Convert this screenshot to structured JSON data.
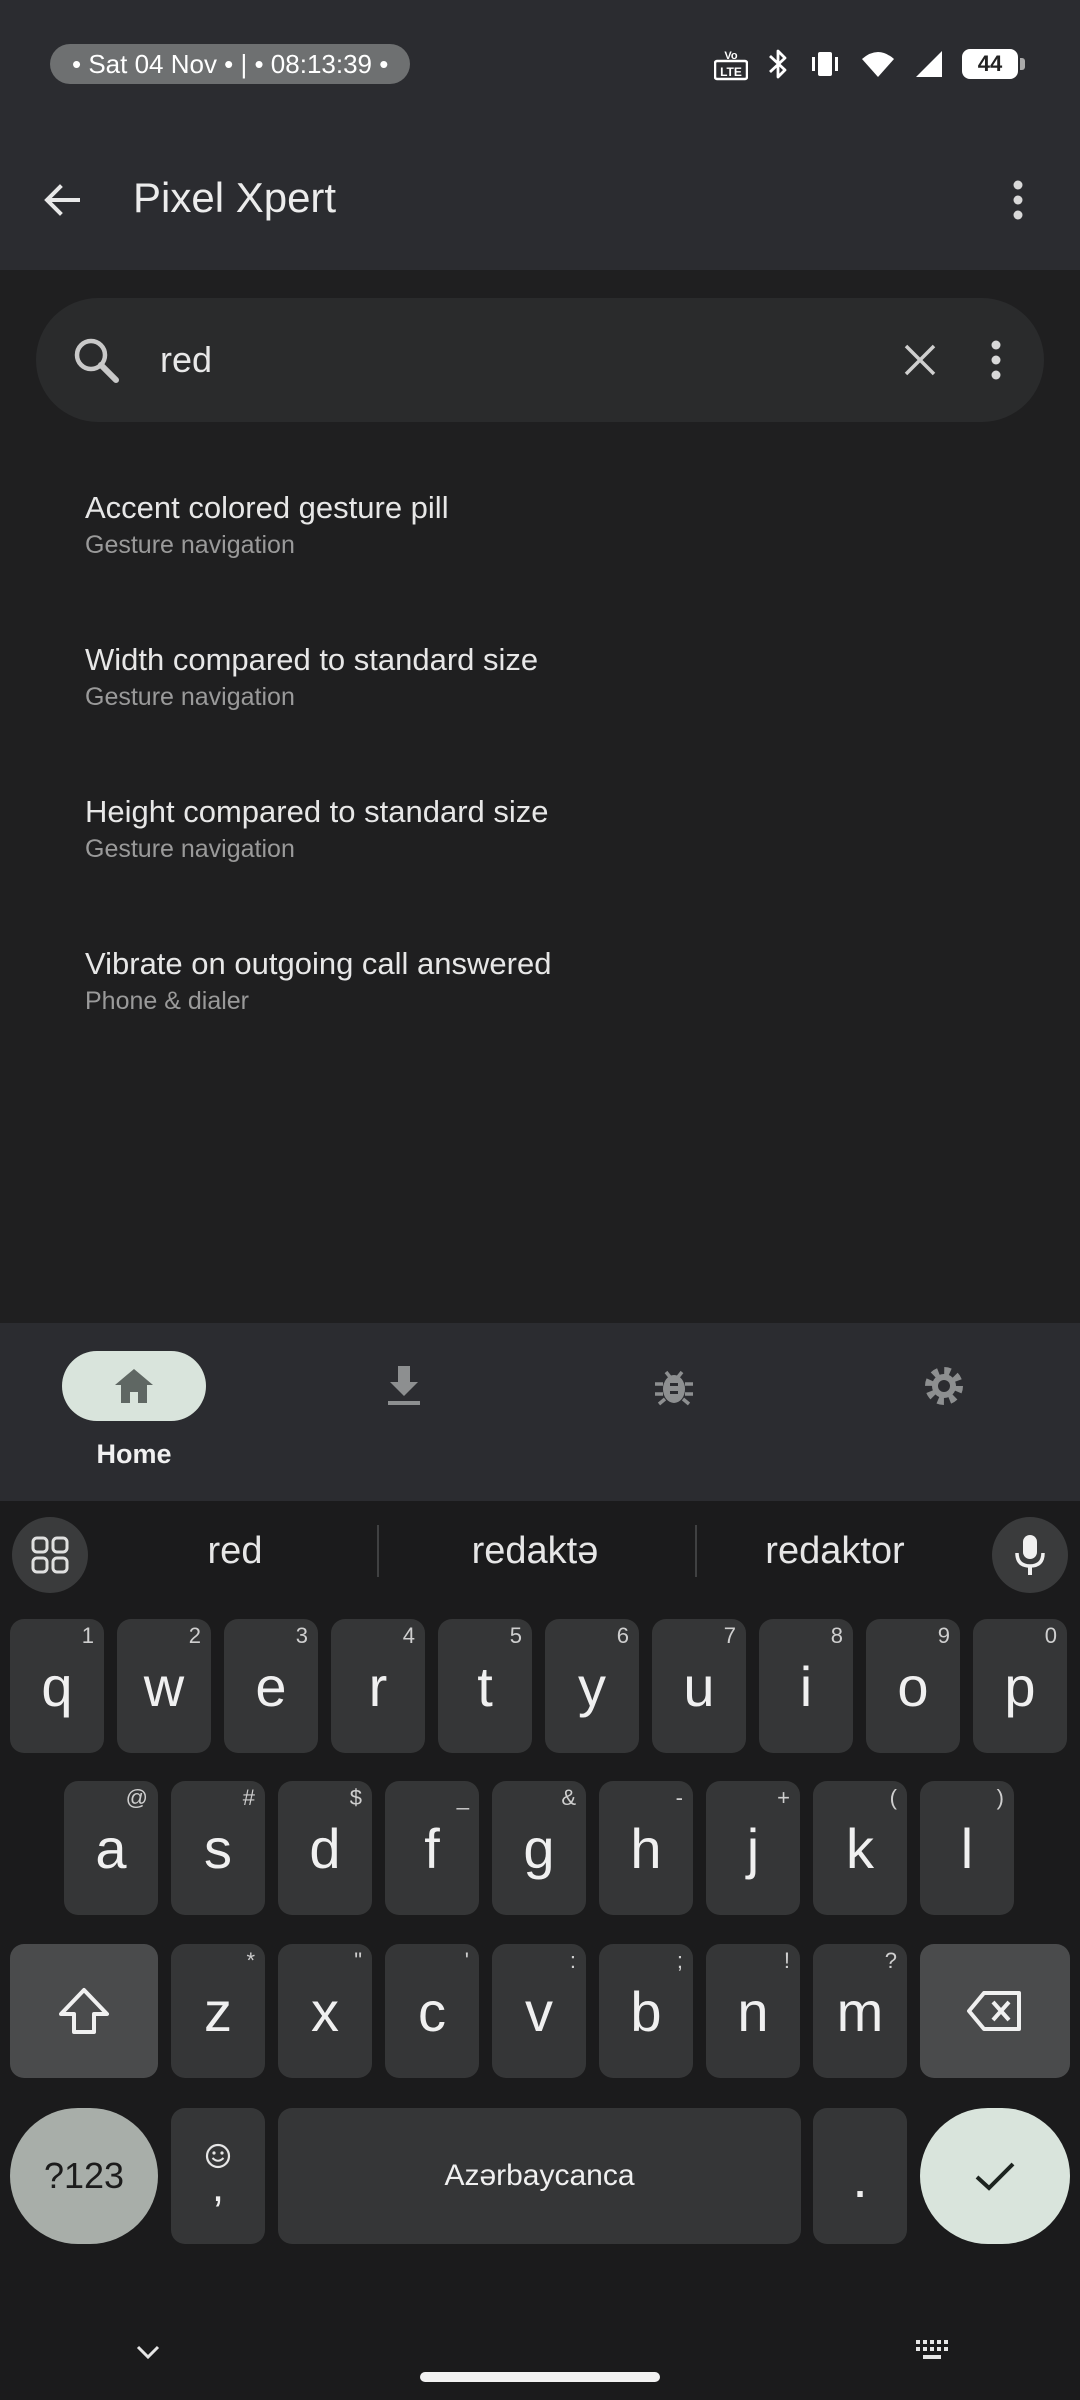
{
  "status_bar": {
    "datetime": "• Sat 04 Nov • | • 08:13:39 •",
    "battery": "44",
    "icons": [
      "volte-icon",
      "bluetooth-icon",
      "vibrate-icon",
      "wifi-icon",
      "signal-icon",
      "battery-icon"
    ]
  },
  "app_bar": {
    "title": "Pixel Xpert"
  },
  "search": {
    "query": "red"
  },
  "results": [
    {
      "title": "Accent colored gesture pill",
      "subtitle": "Gesture navigation"
    },
    {
      "title": "Width compared to standard size",
      "subtitle": "Gesture navigation"
    },
    {
      "title": "Height compared to standard size",
      "subtitle": "Gesture navigation"
    },
    {
      "title": "Vibrate on outgoing call answered",
      "subtitle": "Phone & dialer"
    }
  ],
  "bottom_nav": {
    "items": [
      {
        "label": "Home",
        "icon": "home-icon",
        "active": true
      },
      {
        "label": "",
        "icon": "download-icon",
        "active": false
      },
      {
        "label": "",
        "icon": "bug-icon",
        "active": false
      },
      {
        "label": "",
        "icon": "settings-icon",
        "active": false
      }
    ]
  },
  "keyboard": {
    "suggestions": [
      "red",
      "redaktə",
      "redaktor"
    ],
    "row1": [
      [
        "q",
        "1"
      ],
      [
        "w",
        "2"
      ],
      [
        "e",
        "3"
      ],
      [
        "r",
        "4"
      ],
      [
        "t",
        "5"
      ],
      [
        "y",
        "6"
      ],
      [
        "u",
        "7"
      ],
      [
        "i",
        "8"
      ],
      [
        "o",
        "9"
      ],
      [
        "p",
        "0"
      ]
    ],
    "row2": [
      [
        "a",
        "@"
      ],
      [
        "s",
        "#"
      ],
      [
        "d",
        "$"
      ],
      [
        "f",
        "_"
      ],
      [
        "g",
        "&"
      ],
      [
        "h",
        "-"
      ],
      [
        "j",
        "+"
      ],
      [
        "k",
        "("
      ],
      [
        "l",
        ")"
      ]
    ],
    "row3": [
      [
        "z",
        "*"
      ],
      [
        "x",
        "\""
      ],
      [
        "c",
        "'"
      ],
      [
        "v",
        ":"
      ],
      [
        "b",
        ";"
      ],
      [
        "n",
        "!"
      ],
      [
        "m",
        "?"
      ]
    ],
    "symbols_label": "?123",
    "comma_label": ",",
    "space_label": "Azərbaycanca",
    "period_label": "."
  },
  "colors": {
    "accent": "#d9e4dc",
    "surface": "#2b2c30",
    "background": "#1f1f20"
  }
}
